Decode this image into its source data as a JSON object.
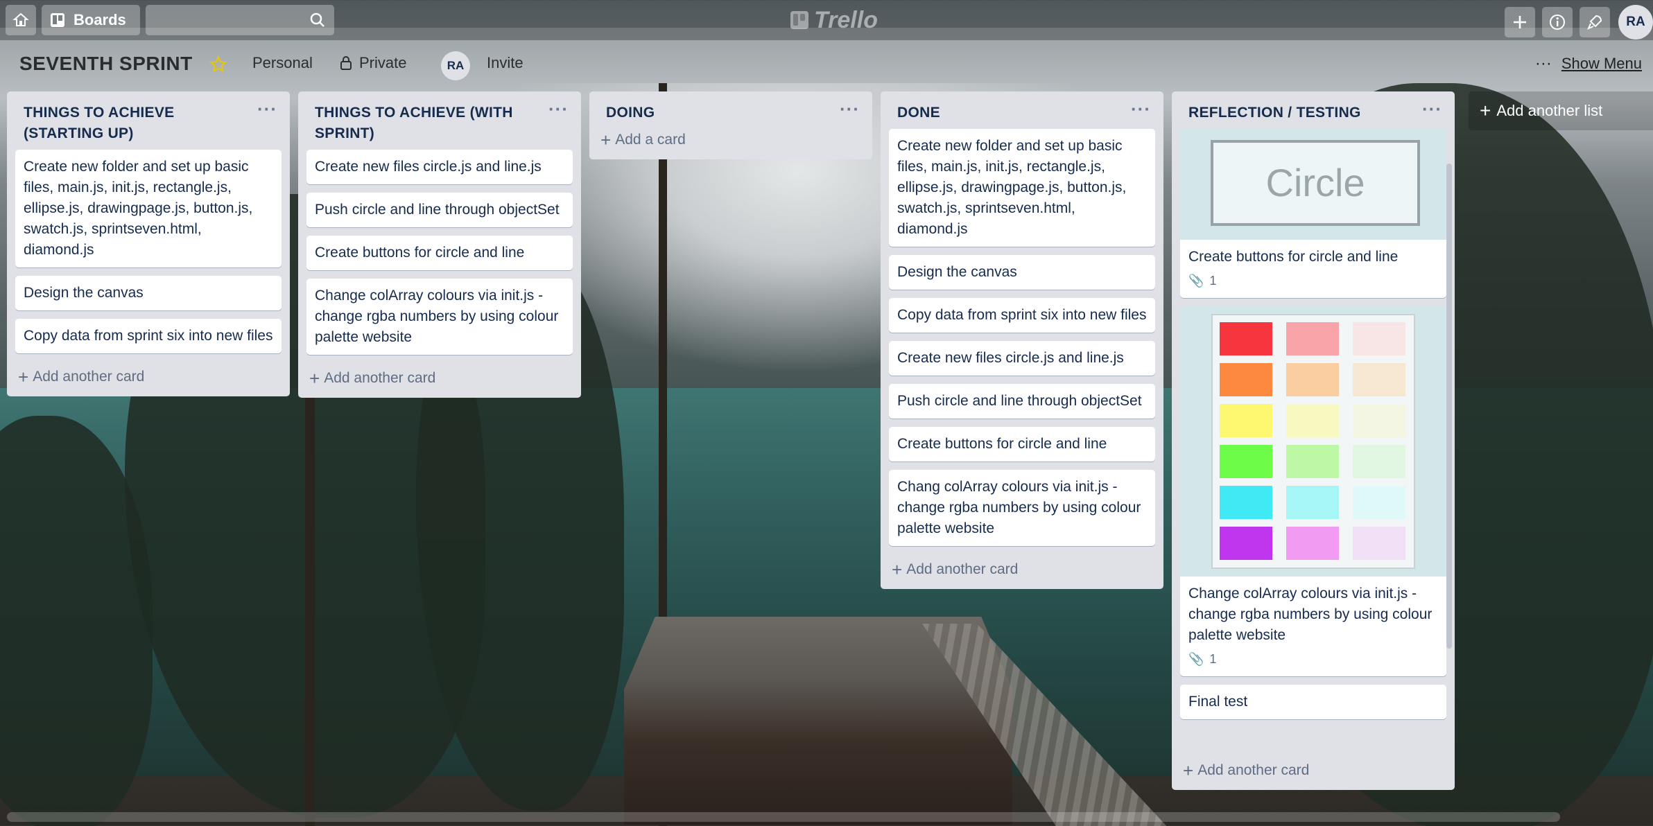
{
  "header": {
    "boards_label": "Boards",
    "logo_text": "Trello",
    "avatar_initials": "RA"
  },
  "board": {
    "title": "SEVENTH SPRINT",
    "visibility_team": "Personal",
    "visibility_privacy": "Private",
    "member_initials": "RA",
    "invite_label": "Invite",
    "show_menu_label": "Show Menu",
    "add_list_label": "Add another list"
  },
  "lists": [
    {
      "title": "THINGS TO ACHIEVE (STARTING UP)",
      "cards": [
        "Create new folder and set up basic files, main.js, init.js, rectangle.js, ellipse.js, drawingpage.js, button.js, swatch.js, sprintseven.html, diamond.js",
        "Design the canvas",
        "Copy data from sprint six into new files"
      ],
      "add_label": "Add another card"
    },
    {
      "title": "THINGS TO ACHIEVE (WITH SPRINT)",
      "cards": [
        "Create new files circle.js and line.js",
        "Push circle and line through objectSet",
        "Create buttons for circle and line",
        "Change colArray colours via init.js - change rgba numbers by using colour palette website"
      ],
      "add_label": "Add another card"
    },
    {
      "title": "DOING",
      "cards": [],
      "add_label": "Add a card"
    },
    {
      "title": "DONE",
      "cards": [
        "Create new folder and set up basic files, main.js, init.js, rectangle.js, ellipse.js, drawingpage.js, button.js, swatch.js, sprintseven.html, diamond.js",
        "Design the canvas",
        "Copy data from sprint six into new files",
        "Create new files circle.js and line.js",
        "Push circle and line through objectSet",
        "Create buttons for circle and line",
        "Chang colArray colours via init.js - change rgba numbers by using colour palette website"
      ],
      "add_label": "Add another card"
    },
    {
      "title": "REFLECTION / TESTING",
      "cards": [
        {
          "title": "Create buttons for circle and line",
          "attachments": "1",
          "cover_text": "Circle"
        },
        {
          "title": "Change colArray colours via init.js - change rgba numbers by using colour palette website",
          "attachments": "1"
        },
        {
          "title": "Final test"
        }
      ],
      "add_label": "Add another card"
    }
  ],
  "palette_colors": [
    "#f7353f",
    "#f9a4a8",
    "#f7e6e5",
    "#fd8840",
    "#f9cda0",
    "#f7e8d2",
    "#fdf870",
    "#f8f9c1",
    "#f3f6e3",
    "#6dfc48",
    "#bdf9a5",
    "#e1f7e2",
    "#40eaf5",
    "#a6f6f5",
    "#dff8f8",
    "#c036ef",
    "#f19cf2",
    "#f1dff5"
  ]
}
